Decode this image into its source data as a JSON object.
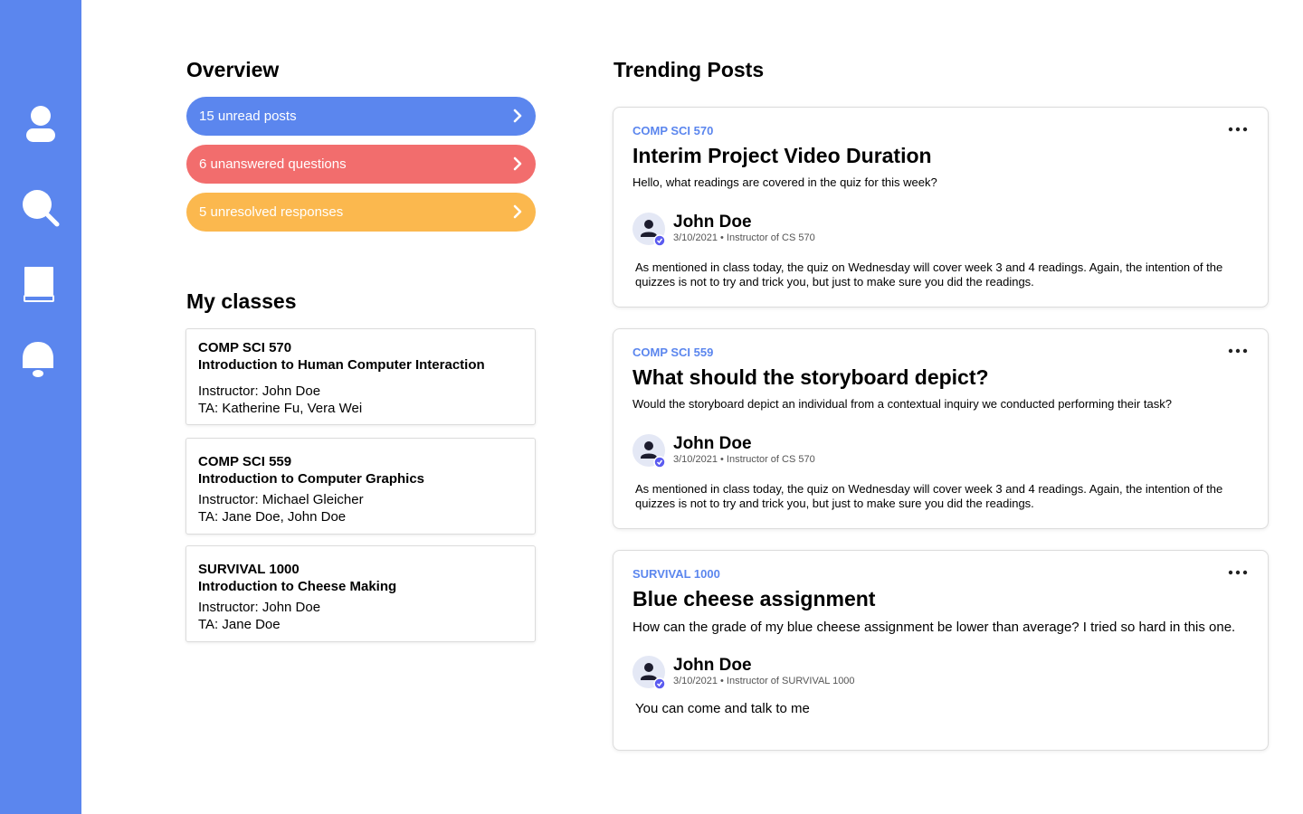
{
  "overview": {
    "title": "Overview",
    "pills": [
      {
        "label": "15 unread posts",
        "color": "#5b86ee"
      },
      {
        "label": "6 unanswered questions",
        "color": "#f26d6d"
      },
      {
        "label": "5 unresolved responses",
        "color": "#fbb84e"
      }
    ]
  },
  "classes": {
    "title": "My classes",
    "items": [
      {
        "code": "COMP SCI 570",
        "name": "Introduction to Human Computer Interaction",
        "instructor": "Instructor: John Doe",
        "ta": "TA: Katherine Fu, Vera Wei"
      },
      {
        "code": "COMP SCI 559",
        "name": "Introduction to Computer Graphics",
        "instructor": "Instructor: Michael Gleicher",
        "ta": "TA: Jane Doe, John Doe"
      },
      {
        "code": "SURVIVAL 1000",
        "name": "Introduction to Cheese Making",
        "instructor": "Instructor: John Doe",
        "ta": "TA: Jane Doe"
      }
    ]
  },
  "trending": {
    "title": "Trending Posts",
    "posts": [
      {
        "course": "COMP SCI 570",
        "title": "Interim Project Video Duration",
        "question": "Hello, what readings are covered in the quiz for this week?",
        "author": "John Doe",
        "meta": "3/10/2021 • Instructor of CS 570",
        "answer": "As mentioned in class today, the quiz on Wednesday will cover week 3 and 4 readings. Again, the intention of the quizzes is not to try and trick you, but just to make sure you did the readings."
      },
      {
        "course": "COMP SCI 559",
        "title": "What should the storyboard depict?",
        "question": "Would the storyboard depict an individual from a contextual inquiry we conducted performing their task?",
        "author": "John Doe",
        "meta": "3/10/2021 • Instructor of CS 570",
        "answer": "As mentioned in class today, the quiz on Wednesday will cover week 3 and 4 readings. Again, the intention of the quizzes is not to try and trick you, but just to make sure you did the readings."
      },
      {
        "course": "SURVIVAL 1000",
        "title": "Blue cheese assignment",
        "question": "How can the grade of my blue cheese assignment be lower than average? I tried so hard in this one.",
        "author": "John Doe",
        "meta": "3/10/2021 • Instructor of SURVIVAL 1000",
        "answer": "You can come and talk to me"
      }
    ]
  },
  "sidebar": {
    "icons": [
      "profile-icon",
      "search-icon",
      "book-icon",
      "bell-icon"
    ],
    "color": "#5b86ee"
  },
  "colors": {
    "accent": "#5b86ee",
    "danger": "#f26d6d",
    "warning": "#fbb84e",
    "verified": "#5b5bf0"
  }
}
